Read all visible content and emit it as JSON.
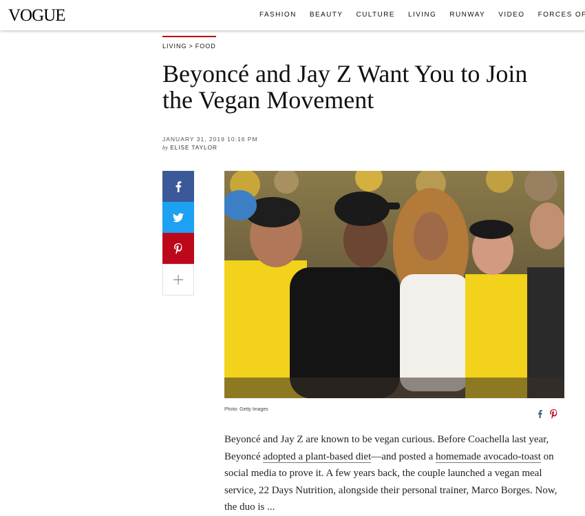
{
  "header": {
    "logo": "VOGUE",
    "nav": [
      "FASHION",
      "BEAUTY",
      "CULTURE",
      "LIVING",
      "RUNWAY",
      "VIDEO",
      "FORCES OF FASHION"
    ]
  },
  "breadcrumb": {
    "section": "LIVING",
    "separator": ">",
    "subsection": "FOOD"
  },
  "article": {
    "title": "Beyoncé and Jay Z Want You to Join the Vegan Movement",
    "date": "JANUARY 31, 2019 10:16 PM",
    "by": "by",
    "author": "ELISE TAYLOR",
    "photo_alt": "Beyoncé and Jay Z courtside at a basketball game",
    "caption": "Photo: Getty Images",
    "body": {
      "p1": "Beyoncé and Jay Z are known to be vegan curious. Before Coachella last year, Beyoncé ",
      "link1": "adopted a plant-based diet",
      "p2": "—and posted a ",
      "link2": "homemade avocado-toast",
      "p3": " on social media to prove it. A few years back, the couple launched a vegan meal service, 22 Days Nutrition, alongside their personal trainer, Marco Borges. Now, the duo is ..."
    }
  },
  "share": {
    "icons": [
      "facebook-icon",
      "twitter-icon",
      "pinterest-icon",
      "plus-icon"
    ]
  },
  "colors": {
    "facebook": "#3b5998",
    "twitter": "#1da1f2",
    "pinterest": "#bd081c",
    "accent_rule": "#b8000b"
  }
}
